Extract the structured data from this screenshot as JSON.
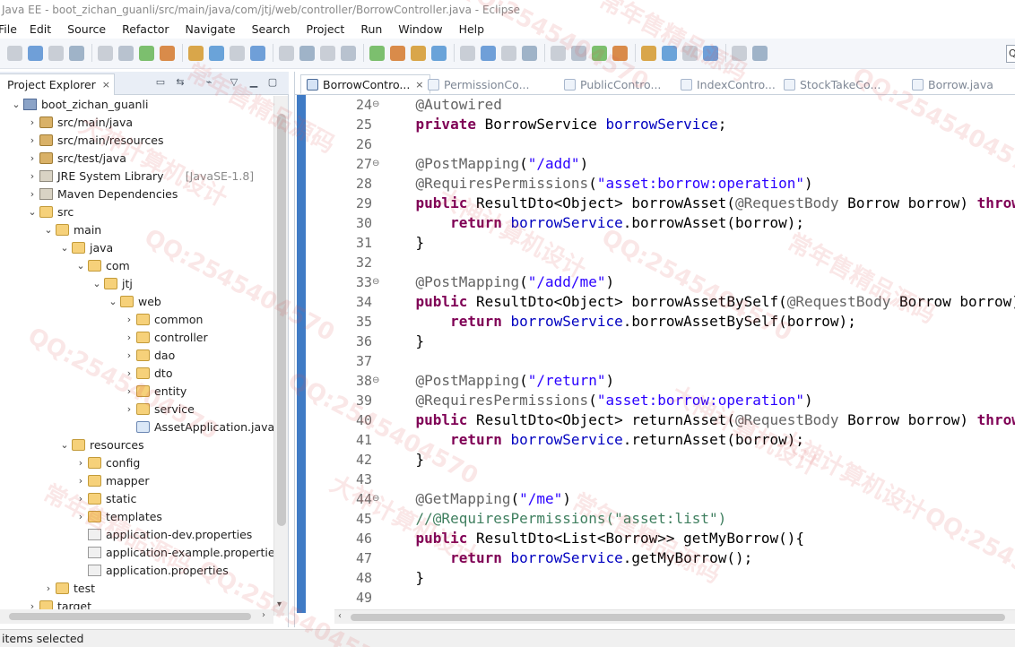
{
  "window": {
    "title": "Java EE - boot_zichan_guanli/src/main/java/com/jtj/web/controller/BorrowController.java - Eclipse"
  },
  "menu": [
    "File",
    "Edit",
    "Source",
    "Refactor",
    "Navigate",
    "Search",
    "Project",
    "Run",
    "Window",
    "Help"
  ],
  "toolbar": {
    "icons": [
      "new-icon",
      "save-icon",
      "save-all-icon",
      "terminal-icon",
      "print-icon",
      "skip-breakpoints-icon",
      "resume-icon",
      "suspend-icon",
      "terminate-icon",
      "disconnect-icon",
      "step-into-icon",
      "step-over-icon",
      "step-return-icon",
      "drop-to-frame-icon",
      "use-step-filters-icon",
      "debug-icon",
      "run-icon",
      "external-tools-icon",
      "new-server-icon",
      "new-java-project-icon",
      "open-type-icon",
      "open-task-icon",
      "search-icon",
      "toggle-breadcrumb-icon",
      "toggle-mark-occurrences-icon",
      "toggle-block-selection-icon",
      "show-whitespace-icon",
      "web-browser-icon",
      "next-annotation-icon",
      "previous-annotation-icon",
      "last-edit-location-icon",
      "back-icon",
      "forward-icon",
      "pin-editor-icon"
    ],
    "search_placeholder": "Q"
  },
  "colors": {
    "ruler": "#3f7bc5",
    "keyword": "#7f0055",
    "string": "#2a00ff",
    "annotation": "#646464",
    "field": "#0000c0",
    "comment": "#3f7f5f"
  },
  "explorer": {
    "title": "Project Explorer",
    "close": "×",
    "tree": [
      {
        "label": "boot_zichan_guanli",
        "hint": "",
        "depth": 0,
        "twisty": "v",
        "icon": "proj"
      },
      {
        "label": "src/main/java",
        "hint": "",
        "depth": 1,
        "twisty": ">",
        "icon": "pkgfolder"
      },
      {
        "label": "src/main/resources",
        "hint": "",
        "depth": 1,
        "twisty": ">",
        "icon": "pkgfolder"
      },
      {
        "label": "src/test/java",
        "hint": "",
        "depth": 1,
        "twisty": ">",
        "icon": "pkgfolder"
      },
      {
        "label": "JRE System Library",
        "hint": "[JavaSE-1.8]",
        "depth": 1,
        "twisty": ">",
        "icon": "lib"
      },
      {
        "label": "Maven Dependencies",
        "hint": "",
        "depth": 1,
        "twisty": ">",
        "icon": "lib"
      },
      {
        "label": "src",
        "hint": "",
        "depth": 1,
        "twisty": "v",
        "icon": "folder"
      },
      {
        "label": "main",
        "hint": "",
        "depth": 2,
        "twisty": "v",
        "icon": "folder"
      },
      {
        "label": "java",
        "hint": "",
        "depth": 3,
        "twisty": "v",
        "icon": "folder"
      },
      {
        "label": "com",
        "hint": "",
        "depth": 4,
        "twisty": "v",
        "icon": "folder"
      },
      {
        "label": "jtj",
        "hint": "",
        "depth": 5,
        "twisty": "v",
        "icon": "folder"
      },
      {
        "label": "web",
        "hint": "",
        "depth": 6,
        "twisty": "v",
        "icon": "folder"
      },
      {
        "label": "common",
        "hint": "",
        "depth": 7,
        "twisty": ">",
        "icon": "folder"
      },
      {
        "label": "controller",
        "hint": "",
        "depth": 7,
        "twisty": ">",
        "icon": "folder"
      },
      {
        "label": "dao",
        "hint": "",
        "depth": 7,
        "twisty": ">",
        "icon": "folder"
      },
      {
        "label": "dto",
        "hint": "",
        "depth": 7,
        "twisty": ">",
        "icon": "folder"
      },
      {
        "label": "entity",
        "hint": "",
        "depth": 7,
        "twisty": ">",
        "icon": "folder"
      },
      {
        "label": "service",
        "hint": "",
        "depth": 7,
        "twisty": ">",
        "icon": "folder"
      },
      {
        "label": "AssetApplication.java",
        "hint": "",
        "depth": 7,
        "twisty": "",
        "icon": "java"
      },
      {
        "label": "resources",
        "hint": "",
        "depth": 3,
        "twisty": "v",
        "icon": "folder"
      },
      {
        "label": "config",
        "hint": "",
        "depth": 4,
        "twisty": ">",
        "icon": "folder"
      },
      {
        "label": "mapper",
        "hint": "",
        "depth": 4,
        "twisty": ">",
        "icon": "folder"
      },
      {
        "label": "static",
        "hint": "",
        "depth": 4,
        "twisty": ">",
        "icon": "folder"
      },
      {
        "label": "templates",
        "hint": "",
        "depth": 4,
        "twisty": ">",
        "icon": "folder"
      },
      {
        "label": "application-dev.properties",
        "hint": "",
        "depth": 4,
        "twisty": "",
        "icon": "props"
      },
      {
        "label": "application-example.properties",
        "hint": "",
        "depth": 4,
        "twisty": "",
        "icon": "props"
      },
      {
        "label": "application.properties",
        "hint": "",
        "depth": 4,
        "twisty": "",
        "icon": "props"
      },
      {
        "label": "test",
        "hint": "",
        "depth": 2,
        "twisty": ">",
        "icon": "folder"
      },
      {
        "label": "target",
        "hint": "",
        "depth": 1,
        "twisty": ">",
        "icon": "folder"
      }
    ]
  },
  "editor": {
    "tabs": [
      {
        "label": "BorrowContro...",
        "active": true
      },
      {
        "label": "PermissionCo...",
        "active": false
      },
      {
        "label": "PublicContro...",
        "active": false
      },
      {
        "label": "IndexContro...",
        "active": false
      },
      {
        "label": "StockTakeCo...",
        "active": false
      },
      {
        "label": "Borrow.java",
        "active": false
      }
    ],
    "tab_close": "×",
    "lines": [
      {
        "n": "24",
        "fold": "⊖",
        "tokens": [
          [
            "plain",
            "    "
          ],
          [
            "annotation",
            "@Autowired"
          ]
        ]
      },
      {
        "n": "25",
        "fold": "",
        "tokens": [
          [
            "plain",
            "    "
          ],
          [
            "keyword",
            "private"
          ],
          [
            "plain",
            " BorrowService "
          ],
          [
            "field",
            "borrowService"
          ],
          [
            "plain",
            ";"
          ]
        ]
      },
      {
        "n": "26",
        "fold": "",
        "tokens": []
      },
      {
        "n": "27",
        "fold": "⊖",
        "tokens": [
          [
            "plain",
            "    "
          ],
          [
            "annotation",
            "@PostMapping"
          ],
          [
            "plain",
            "("
          ],
          [
            "string",
            "\"/add\""
          ],
          [
            "plain",
            ")"
          ]
        ]
      },
      {
        "n": "28",
        "fold": "",
        "tokens": [
          [
            "plain",
            "    "
          ],
          [
            "annotation",
            "@RequiresPermissions"
          ],
          [
            "plain",
            "("
          ],
          [
            "string",
            "\"asset:borrow:operation\""
          ],
          [
            "plain",
            ")"
          ]
        ]
      },
      {
        "n": "29",
        "fold": "",
        "tokens": [
          [
            "plain",
            "    "
          ],
          [
            "keyword",
            "public"
          ],
          [
            "plain",
            " ResultDto<Object> borrowAsset("
          ],
          [
            "annotation",
            "@RequestBody"
          ],
          [
            "plain",
            " Borrow borrow) "
          ],
          [
            "keyword",
            "throws"
          ]
        ]
      },
      {
        "n": "30",
        "fold": "",
        "tokens": [
          [
            "plain",
            "        "
          ],
          [
            "keyword",
            "return"
          ],
          [
            "plain",
            " "
          ],
          [
            "field",
            "borrowService"
          ],
          [
            "plain",
            ".borrowAsset(borrow);"
          ]
        ]
      },
      {
        "n": "31",
        "fold": "",
        "tokens": [
          [
            "plain",
            "    }"
          ]
        ]
      },
      {
        "n": "32",
        "fold": "",
        "tokens": []
      },
      {
        "n": "33",
        "fold": "⊖",
        "tokens": [
          [
            "plain",
            "    "
          ],
          [
            "annotation",
            "@PostMapping"
          ],
          [
            "plain",
            "("
          ],
          [
            "string",
            "\"/add/me\""
          ],
          [
            "plain",
            ")"
          ]
        ]
      },
      {
        "n": "34",
        "fold": "",
        "tokens": [
          [
            "plain",
            "    "
          ],
          [
            "keyword",
            "public"
          ],
          [
            "plain",
            " ResultDto<Object> borrowAssetBySelf("
          ],
          [
            "annotation",
            "@RequestBody"
          ],
          [
            "plain",
            " Borrow borrow) t"
          ]
        ]
      },
      {
        "n": "35",
        "fold": "",
        "tokens": [
          [
            "plain",
            "        "
          ],
          [
            "keyword",
            "return"
          ],
          [
            "plain",
            " "
          ],
          [
            "field",
            "borrowService"
          ],
          [
            "plain",
            ".borrowAssetBySelf(borrow);"
          ]
        ]
      },
      {
        "n": "36",
        "fold": "",
        "tokens": [
          [
            "plain",
            "    }"
          ]
        ]
      },
      {
        "n": "37",
        "fold": "",
        "tokens": []
      },
      {
        "n": "38",
        "fold": "⊖",
        "tokens": [
          [
            "plain",
            "    "
          ],
          [
            "annotation",
            "@PostMapping"
          ],
          [
            "plain",
            "("
          ],
          [
            "string",
            "\"/return\""
          ],
          [
            "plain",
            ")"
          ]
        ]
      },
      {
        "n": "39",
        "fold": "",
        "tokens": [
          [
            "plain",
            "    "
          ],
          [
            "annotation",
            "@RequiresPermissions"
          ],
          [
            "plain",
            "("
          ],
          [
            "string",
            "\"asset:borrow:operation\""
          ],
          [
            "plain",
            ")"
          ]
        ]
      },
      {
        "n": "40",
        "fold": "",
        "tokens": [
          [
            "plain",
            "    "
          ],
          [
            "keyword",
            "public"
          ],
          [
            "plain",
            " ResultDto<Object> returnAsset("
          ],
          [
            "annotation",
            "@RequestBody"
          ],
          [
            "plain",
            " Borrow borrow) "
          ],
          [
            "keyword",
            "throws"
          ]
        ]
      },
      {
        "n": "41",
        "fold": "",
        "tokens": [
          [
            "plain",
            "        "
          ],
          [
            "keyword",
            "return"
          ],
          [
            "plain",
            " "
          ],
          [
            "field",
            "borrowService"
          ],
          [
            "plain",
            ".returnAsset(borrow);"
          ]
        ]
      },
      {
        "n": "42",
        "fold": "",
        "tokens": [
          [
            "plain",
            "    }"
          ]
        ]
      },
      {
        "n": "43",
        "fold": "",
        "tokens": []
      },
      {
        "n": "44",
        "fold": "⊖",
        "tokens": [
          [
            "plain",
            "    "
          ],
          [
            "annotation",
            "@GetMapping"
          ],
          [
            "plain",
            "("
          ],
          [
            "string",
            "\"/me\""
          ],
          [
            "plain",
            ")"
          ]
        ]
      },
      {
        "n": "45",
        "fold": "",
        "tokens": [
          [
            "plain",
            "    "
          ],
          [
            "comment",
            "//@RequiresPermissions(\"asset:list\")"
          ]
        ]
      },
      {
        "n": "46",
        "fold": "",
        "tokens": [
          [
            "plain",
            "    "
          ],
          [
            "keyword",
            "public"
          ],
          [
            "plain",
            " ResultDto<List<Borrow>> getMyBorrow(){"
          ]
        ]
      },
      {
        "n": "47",
        "fold": "",
        "tokens": [
          [
            "plain",
            "        "
          ],
          [
            "keyword",
            "return"
          ],
          [
            "plain",
            " "
          ],
          [
            "field",
            "borrowService"
          ],
          [
            "plain",
            ".getMyBorrow();"
          ]
        ]
      },
      {
        "n": "48",
        "fold": "",
        "tokens": [
          [
            "plain",
            "    }"
          ]
        ]
      },
      {
        "n": "49",
        "fold": "",
        "tokens": []
      }
    ]
  },
  "status": {
    "text": "items selected"
  },
  "watermark": {
    "texts": [
      "QQ:2545404570",
      "常年售精品源码",
      "大神计算机设计"
    ]
  }
}
